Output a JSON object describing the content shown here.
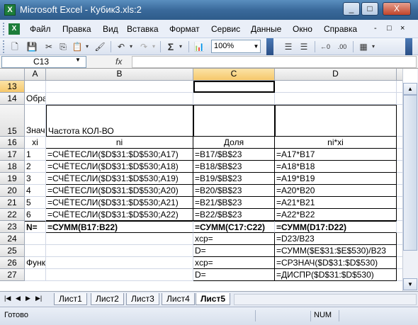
{
  "window": {
    "title": "Microsoft Excel - Кубик3.xls:2",
    "minimize": "_",
    "restore": "□",
    "close": "X"
  },
  "menu": {
    "items": [
      "Файл",
      "Правка",
      "Вид",
      "Вставка",
      "Формат",
      "Сервис",
      "Данные",
      "Окно",
      "Справка"
    ],
    "controls": [
      "-",
      "□",
      "×"
    ]
  },
  "toolbar": {
    "zoom": "100%",
    "sum": "Σ"
  },
  "formula_bar": {
    "name_box": "C13",
    "fx": "fx",
    "formula": ""
  },
  "columns": [
    "A",
    "B",
    "C",
    "D"
  ],
  "rows": [
    {
      "num": "13",
      "cells": [
        "",
        "",
        "",
        ""
      ]
    },
    {
      "num": "14",
      "cells": [
        "Обра",
        "",
        "",
        ""
      ]
    },
    {
      "num": "15",
      "cells": [
        "Знач",
        "Частота КОЛ-ВО",
        "",
        ""
      ]
    },
    {
      "num": "16",
      "cells": [
        "xi",
        "ni",
        "Доля",
        "ni*xi"
      ]
    },
    {
      "num": "17",
      "cells": [
        "1",
        "=СЧЁТЕСЛИ($D$31:$D$530;A17)",
        "=B17/$B$23",
        "=A17*B17"
      ]
    },
    {
      "num": "18",
      "cells": [
        "2",
        "=СЧЁТЕСЛИ($D$31:$D$530;A18)",
        "=B18/$B$23",
        "=A18*B18"
      ]
    },
    {
      "num": "19",
      "cells": [
        "3",
        "=СЧЁТЕСЛИ($D$31:$D$530;A19)",
        "=B19/$B$23",
        "=A19*B19"
      ]
    },
    {
      "num": "20",
      "cells": [
        "4",
        "=СЧЁТЕСЛИ($D$31:$D$530;A20)",
        "=B20/$B$23",
        "=A20*B20"
      ]
    },
    {
      "num": "21",
      "cells": [
        "5",
        "=СЧЁТЕСЛИ($D$31:$D$530;A21)",
        "=B21/$B$23",
        "=A21*B21"
      ]
    },
    {
      "num": "22",
      "cells": [
        "6",
        "=СЧЁТЕСЛИ($D$31:$D$530;A22)",
        "=B22/$B$23",
        "=A22*B22"
      ]
    },
    {
      "num": "23",
      "cells": [
        "N=",
        "=СУММ(B17:B22)",
        "=СУММ(C17:C22)",
        "=СУММ(D17:D22)"
      ]
    },
    {
      "num": "24",
      "cells": [
        "",
        "",
        "xcp=",
        "=D23/B23"
      ]
    },
    {
      "num": "25",
      "cells": [
        "",
        "",
        "D=",
        "=СУММ($E$31:$E$530)/B23"
      ]
    },
    {
      "num": "26",
      "cells": [
        "Функ",
        "",
        "xcp=",
        "=СРЗНАЧ($D$31:$D$530)"
      ]
    },
    {
      "num": "27",
      "cells": [
        "",
        "",
        "D=",
        "=ДИСПР($D$31:$D$530)"
      ]
    }
  ],
  "sheet_tabs": [
    "Лист1",
    "Лист2",
    "Лист3",
    "Лист4",
    "Лист5"
  ],
  "active_tab": "Лист5",
  "status": {
    "text": "Готово",
    "num": "NUM"
  }
}
